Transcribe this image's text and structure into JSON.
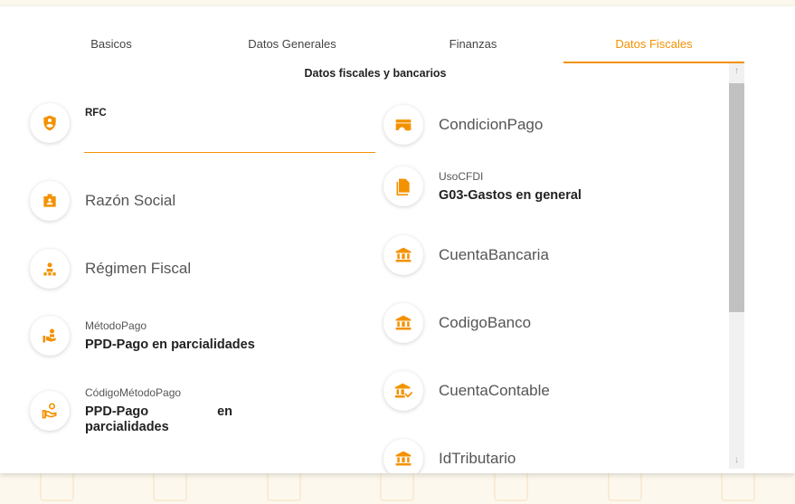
{
  "tabs": [
    {
      "label": "Basicos",
      "active": false
    },
    {
      "label": "Datos Generales",
      "active": false
    },
    {
      "label": "Finanzas",
      "active": false
    },
    {
      "label": "Datos Fiscales",
      "active": true
    }
  ],
  "section_title": "Datos fiscales y bancarios",
  "accent_color": "#f39200",
  "left_fields": [
    {
      "label": "RFC",
      "value": "",
      "icon": "shield-user-icon"
    },
    {
      "placeholder": "Razón Social",
      "icon": "id-badge-icon"
    },
    {
      "placeholder": "Régimen Fiscal",
      "icon": "org-person-icon"
    },
    {
      "label": "MétodoPago",
      "value": "PPD-Pago en parcialidades",
      "icon": "hand-person-icon"
    },
    {
      "label": "CódigoMétodoPago",
      "value_line1": "PPD-Pago",
      "value_line1b": "en",
      "value_line2": "parcialidades",
      "icon": "hand-coins-icon"
    }
  ],
  "right_fields": [
    {
      "placeholder": "CondicionPago",
      "icon": "card-settings-icon"
    },
    {
      "label": "UsoCFDI",
      "value": "G03-Gastos en general",
      "icon": "document-icon"
    },
    {
      "placeholder": "CuentaBancaria",
      "icon": "bank-icon"
    },
    {
      "placeholder": "CodigoBanco",
      "icon": "bank-icon"
    },
    {
      "placeholder": "CuentaContable",
      "icon": "bank-check-icon"
    },
    {
      "placeholder": "IdTributario",
      "icon": "bank-icon"
    }
  ],
  "scrollbar": {
    "up": "↑",
    "down": "↓"
  }
}
